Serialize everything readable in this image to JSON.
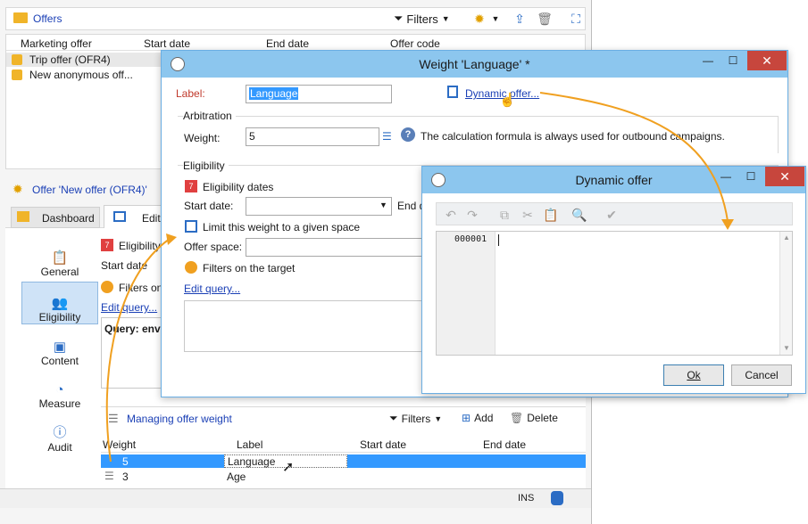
{
  "offers_panel": {
    "title": "Offers",
    "toolbar": {
      "filters": "Filters"
    },
    "columns": [
      "Marketing offer",
      "Start date",
      "End date",
      "Offer code"
    ],
    "rows": [
      {
        "name": "Trip offer (OFR4)"
      },
      {
        "name": "New anonymous off..."
      }
    ]
  },
  "offer_editor": {
    "title": "Offer 'New offer (OFR4)'",
    "tabs": [
      "Dashboard",
      "Edit"
    ],
    "sidebar": [
      "General",
      "Eligibility",
      "Content",
      "Measure",
      "Audit"
    ],
    "eligibility_label": "Eligibility",
    "start_date_label": "Start date",
    "filters_label": "Filters on",
    "edit_query": "Edit query...",
    "query_text": "Query: envi",
    "weights": {
      "title": "Managing offer weight",
      "filters": "Filters",
      "add": "Add",
      "delete": "Delete",
      "columns": [
        "Weight",
        "Label",
        "Start date",
        "End date"
      ],
      "rows": [
        {
          "weight": "5",
          "label": "Language"
        },
        {
          "weight": "3",
          "label": "Age"
        }
      ]
    },
    "status": {
      "ins": "INS"
    }
  },
  "weight_dialog": {
    "title": "Weight 'Language' *",
    "label_caption": "Label:",
    "label_value": "Language",
    "dynamic_offer_link": "Dynamic offer...",
    "arbitration": "Arbitration",
    "weight_caption": "Weight:",
    "weight_value": "5",
    "help_text": "The calculation formula is always used for outbound campaigns.",
    "eligibility": "Eligibility",
    "eligibility_dates": "Eligibility dates",
    "start_date": "Start date:",
    "end_date_partial": "End d",
    "limit_space": "Limit this weight to a given space",
    "offer_space": "Offer space:",
    "filters_target": "Filters on the target",
    "edit_query": "Edit query..."
  },
  "dynamic_dialog": {
    "title": "Dynamic offer",
    "editor_text": "000001",
    "ok": "Ok",
    "cancel": "Cancel"
  },
  "colors": {
    "accent": "#f0a020",
    "titlebar": "#8cc6ee",
    "selection": "#3399ff",
    "link": "#1a3fb5"
  }
}
